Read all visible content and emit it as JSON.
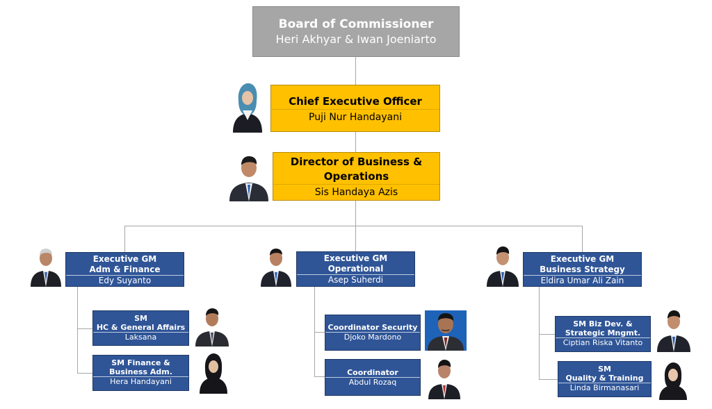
{
  "board": {
    "title": "Board of Commissioner",
    "names": "Heri Akhyar & Iwan Joeniarto"
  },
  "ceo": {
    "title": "Chief Executive Officer",
    "name": "Puji Nur Handayani"
  },
  "director": {
    "title_line1": "Director of Business &",
    "title_line2": "Operations",
    "name": "Sis Handaya Azis"
  },
  "egm_finance": {
    "line1": "Executive GM",
    "line2": "Adm & Finance",
    "name": "Edy Suyanto"
  },
  "egm_operational": {
    "line1": "Executive GM",
    "line2": "Operational",
    "name": "Asep Suherdi"
  },
  "egm_strategy": {
    "line1": "Executive GM",
    "line2": "Business Strategy",
    "name": "Eldira Umar Ali Zain"
  },
  "sm_hc": {
    "line1": "SM",
    "line2": "HC & General Affairs",
    "name": "Laksana"
  },
  "sm_finance": {
    "line1": "SM Finance &",
    "line2": "Business Adm.",
    "name": "Hera Handayani"
  },
  "coord_security": {
    "line1": "Coordinator Security",
    "name": "Djoko Mardono"
  },
  "coord": {
    "line1": "Coordinator",
    "name": "Abdul Rozaq"
  },
  "sm_bizdev": {
    "line1": "SM Biz Dev. &",
    "line2": "Strategic Mngmt.",
    "name": "Ciptian Riska Vitanto"
  },
  "sm_quality": {
    "line1": "SM",
    "line2": "Quality & Training",
    "name": "Linda Birmanasari"
  },
  "colors": {
    "board": "#a6a6a6",
    "executive": "#ffc000",
    "management": "#2f5597",
    "connector": "#a6a6a6"
  }
}
